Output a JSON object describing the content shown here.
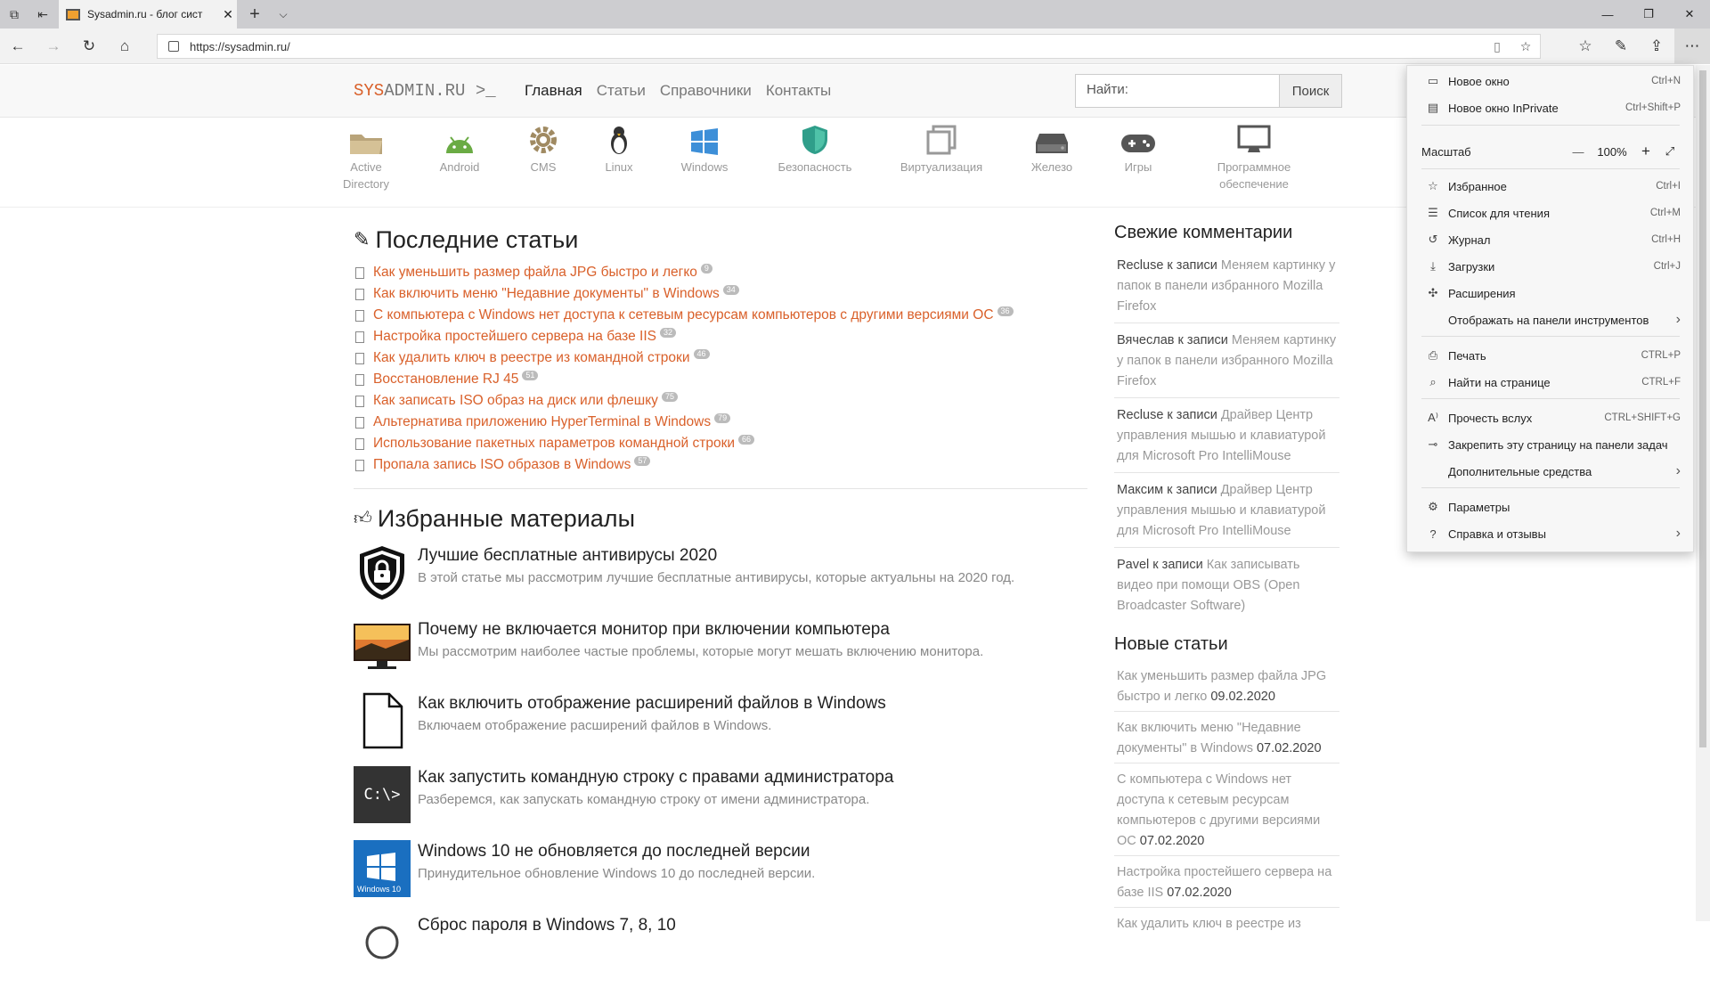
{
  "tab": {
    "title": "Sysadmin.ru - блог сист",
    "close": "✕"
  },
  "address": {
    "url": "https://sysadmin.ru/"
  },
  "site": {
    "logo_a": "SYS",
    "logo_b": "ADMIN.RU >_",
    "nav": [
      "Главная",
      "Статьи",
      "Справочники",
      "Контакты"
    ],
    "search_placeholder": "Найти:",
    "search_button": "Поиск",
    "categories": [
      {
        "label": "Active Directory",
        "icon": "folder-icon"
      },
      {
        "label": "Android",
        "icon": "android-icon"
      },
      {
        "label": "CMS",
        "icon": "gear-icon"
      },
      {
        "label": "Linux",
        "icon": "penguin-icon"
      },
      {
        "label": "Windows",
        "icon": "windows-icon"
      },
      {
        "label": "Безопасность",
        "icon": "shield-icon"
      },
      {
        "label": "Виртуализация",
        "icon": "copy-icon"
      },
      {
        "label": "Железо",
        "icon": "hdd-icon"
      },
      {
        "label": "Игры",
        "icon": "gamepad-icon"
      },
      {
        "label": "Программное обеспечение",
        "icon": "monitor-icon"
      }
    ]
  },
  "latest": {
    "heading": "Последние статьи",
    "items": [
      {
        "title": "Как уменьшить размер файла JPG быстро и легко",
        "count": "9"
      },
      {
        "title": "Как включить меню \"Недавние документы\" в Windows",
        "count": "34"
      },
      {
        "title": "С компьютера с Windows нет доступа к сетевым ресурсам компьютеров с другими версиями ОС",
        "count": "36"
      },
      {
        "title": "Настройка простейшего сервера на базе IIS",
        "count": "32"
      },
      {
        "title": "Как удалить ключ в реестре из командной строки",
        "count": "46"
      },
      {
        "title": "Восстановление RJ 45",
        "count": "51"
      },
      {
        "title": "Как записать ISO образ на диск или флешку",
        "count": "75"
      },
      {
        "title": "Альтернатива приложению HyperTerminal в Windows",
        "count": "79"
      },
      {
        "title": "Использование пакетных параметров командной строки",
        "count": "66"
      },
      {
        "title": "Пропала запись ISO образов в Windows",
        "count": "57"
      }
    ]
  },
  "featured": {
    "heading": "Избранные материалы",
    "items": [
      {
        "title": "Лучшие бесплатные антивирусы 2020",
        "desc": "В этой статье мы рассмотрим лучшие бесплатные антивирусы, которые актуальны на 2020 год.",
        "thumb": "lock-shield"
      },
      {
        "title": "Почему не включается монитор при включении компьютера",
        "desc": "Мы рассмотрим наиболее частые проблемы, которые могут мешать включению монитора.",
        "thumb": "monitor"
      },
      {
        "title": "Как включить отображение расширений файлов в Windows",
        "desc": "Включаем отображение расширений файлов в Windows.",
        "thumb": "file"
      },
      {
        "title": "Как запустить командную строку с правами администратора",
        "desc": "Разберемся, как запускать командную строку от имени администратора.",
        "thumb": "cmd",
        "cmd_text": "C:\\>"
      },
      {
        "title": "Windows 10 не обновляется до последней версии",
        "desc": "Принудительное обновление Windows 10 до последней версии.",
        "thumb": "win10",
        "win_text": "Windows 10"
      },
      {
        "title": "Сброс пароля в Windows 7, 8, 10",
        "desc": "",
        "thumb": "circle"
      }
    ]
  },
  "comments": {
    "heading": "Свежие комментарии",
    "sep": " к записи ",
    "items": [
      {
        "author": "Recluse",
        "post": "Меняем картинку у папок в панели избранного Mozilla Firefox"
      },
      {
        "author": "Вячеслав",
        "post": "Меняем картинку у папок в панели избранного Mozilla Firefox"
      },
      {
        "author": "Recluse",
        "post": "Драйвер Центр управления мышью и клавиатурой для Microsoft Pro IntelliMouse"
      },
      {
        "author": "Максим",
        "post": "Драйвер Центр управления мышью и клавиатурой для Microsoft Pro IntelliMouse"
      },
      {
        "author": "Pavel",
        "post": "Как записывать видео при помощи OBS (Open Broadcaster Software)"
      }
    ]
  },
  "new_articles": {
    "heading": "Новые статьи",
    "items": [
      {
        "title": "Как уменьшить размер файла JPG быстро и легко",
        "date": "09.02.2020"
      },
      {
        "title": "Как включить меню \"Недавние документы\" в Windows",
        "date": "07.02.2020"
      },
      {
        "title": "С компьютера с Windows нет доступа к сетевым ресурсам компьютеров с другими версиями ОС",
        "date": "07.02.2020"
      },
      {
        "title": "Настройка простейшего сервера на базе IIS",
        "date": "07.02.2020"
      },
      {
        "title": "Как удалить ключ в реестре из",
        "date": ""
      }
    ]
  },
  "menu": {
    "items": [
      {
        "label": "Новое окно",
        "shortcut": "Ctrl+N",
        "icon": "window-icon"
      },
      {
        "label": "Новое окно InPrivate",
        "shortcut": "Ctrl+Shift+P",
        "icon": "inprivate-icon"
      },
      {
        "label": "Избранное",
        "shortcut": "Ctrl+I",
        "icon": "favorites-icon"
      },
      {
        "label": "Список для чтения",
        "shortcut": "Ctrl+M",
        "icon": "reading-list-icon"
      },
      {
        "label": "Журнал",
        "shortcut": "Ctrl+H",
        "icon": "history-icon"
      },
      {
        "label": "Загрузки",
        "shortcut": "Ctrl+J",
        "icon": "download-icon"
      },
      {
        "label": "Расширения",
        "shortcut": "",
        "icon": "extensions-icon"
      },
      {
        "label": "Отображать на панели инструментов",
        "shortcut": "",
        "icon": ""
      },
      {
        "label": "Печать",
        "shortcut": "CTRL+P",
        "icon": "print-icon"
      },
      {
        "label": "Найти на странице",
        "shortcut": "CTRL+F",
        "icon": "find-icon"
      },
      {
        "label": "Прочесть вслух",
        "shortcut": "CTRL+SHIFT+G",
        "icon": "read-aloud-icon"
      },
      {
        "label": "Закрепить эту страницу на панели задач",
        "shortcut": "",
        "icon": "pin-icon"
      },
      {
        "label": "Дополнительные средства",
        "shortcut": "",
        "icon": ""
      },
      {
        "label": "Параметры",
        "shortcut": "",
        "icon": "settings-icon"
      },
      {
        "label": "Справка и отзывы",
        "shortcut": "",
        "icon": "help-icon"
      }
    ],
    "zoom": {
      "label": "Масштаб",
      "value": "100%",
      "minus": "—",
      "plus": "+",
      "full": "⤢"
    }
  }
}
